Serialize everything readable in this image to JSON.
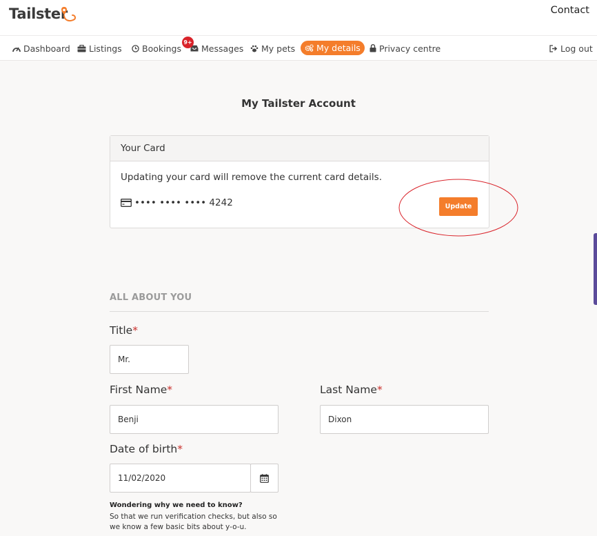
{
  "header": {
    "logo_text": "Tailster",
    "contact_label": "Contact"
  },
  "nav": {
    "items": [
      {
        "label": "Dashboard",
        "icon": "dashboard-icon"
      },
      {
        "label": "Listings",
        "icon": "briefcase-icon"
      },
      {
        "label": "Bookings",
        "icon": "clock-icon"
      },
      {
        "label": "Messages",
        "icon": "inbox-icon"
      },
      {
        "label": "My pets",
        "icon": "paw-icon"
      },
      {
        "label": "My details",
        "icon": "gears-icon",
        "active": true
      },
      {
        "label": "Privacy centre",
        "icon": "lock-icon"
      }
    ],
    "messages_badge": "9+",
    "logout_label": "Log out"
  },
  "page": {
    "title": "My Tailster Account"
  },
  "card": {
    "header": "Your Card",
    "message": "Updating your card will remove the current card details.",
    "masked_number": "•••• •••• •••• 4242",
    "update_label": "Update"
  },
  "about": {
    "section_title": "ALL ABOUT YOU",
    "title_label": "Title",
    "title_value": "Mr.",
    "first_name_label": "First Name",
    "first_name_value": "Benji",
    "last_name_label": "Last Name",
    "last_name_value": "Dixon",
    "dob_label": "Date of birth",
    "dob_value": "11/02/2020",
    "required_mark": "*",
    "help_title": "Wondering why we need to know?",
    "help_body": "So that we run verification checks, but also so we know a few basic bits about y-o-u."
  },
  "colors": {
    "brand_orange": "#f47d2b",
    "badge_red": "#d9232a",
    "annotation_red": "#d9232a",
    "required_red": "#c9302c"
  }
}
